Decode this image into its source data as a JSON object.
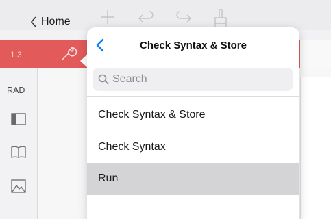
{
  "topbar": {
    "home_label": "Home",
    "icons": [
      "chevron-left-icon",
      "plus-icon",
      "undo-icon",
      "redo-icon",
      "brush-icon"
    ]
  },
  "tabs": {
    "page_number": "1.3",
    "wrench_icon": "wrench-icon",
    "accent_color": "#e25a5a"
  },
  "sidebar": {
    "angle_mode": "RAD",
    "icons": [
      "layout-panel-icon",
      "book-icon",
      "image-icon"
    ]
  },
  "popover": {
    "title": "Check Syntax & Store",
    "back_icon": "chevron-left-icon",
    "search_placeholder": "Search",
    "search_value": "",
    "items": [
      {
        "label": "Check Syntax & Store",
        "selected": false
      },
      {
        "label": "Check Syntax",
        "selected": false
      },
      {
        "label": "Run",
        "selected": true
      }
    ],
    "accent_color": "#0a7aff",
    "selected_color": "#d4d4d6"
  }
}
